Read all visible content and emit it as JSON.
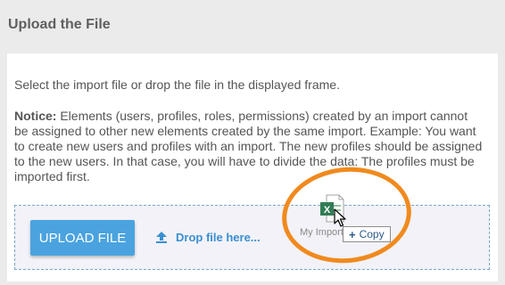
{
  "header": {
    "title": "Upload the File"
  },
  "content": {
    "intro": "Select the import file or drop the file in the displayed frame.",
    "notice_label": "Notice:",
    "notice_text": " Elements (users, profiles, roles, permissions) created by an import cannot be assigned to other new elements created by the same import. Example: You want to create new users and profiles with an import. The new profiles should be assigned to the new users. In that case, you will have to divide the data: The profiles must be imported first."
  },
  "dropzone": {
    "upload_button": "Upload file",
    "drop_hint": "Drop file here...",
    "upload_icon": "upload-arrow-icon"
  },
  "drag_overlay": {
    "file_name": "My Import",
    "file_icon": "excel-file-icon",
    "copy_label": "Copy",
    "copy_icon": "plus-icon"
  },
  "colors": {
    "accent": "#4aa3df",
    "link": "#3a8fd1",
    "highlight": "#f08a1e",
    "excel": "#1e7145"
  }
}
